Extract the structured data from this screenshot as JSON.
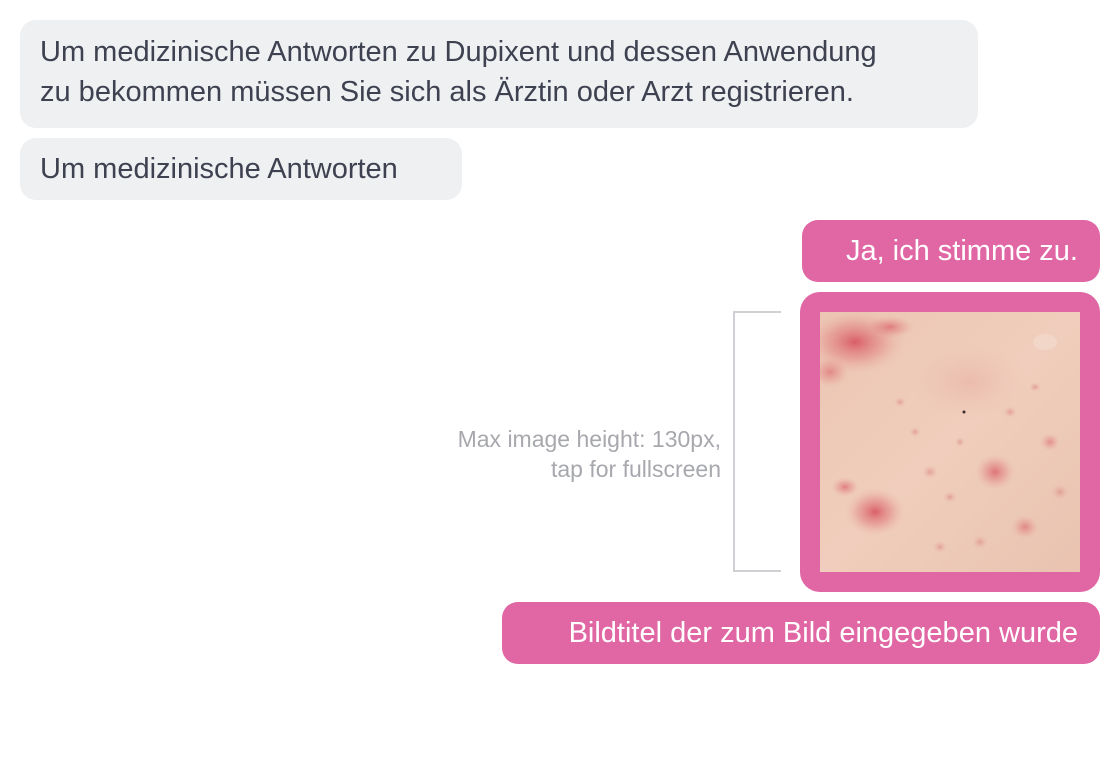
{
  "conversation": {
    "messages": [
      {
        "sender": "bot",
        "lines": [
          "Um medizinische Antworten zu Dupixent und dessen Anwendung",
          "zu bekommen müssen Sie sich als Ärztin oder Arzt registrieren."
        ]
      },
      {
        "sender": "bot",
        "text": "Um medizinische Antworten"
      },
      {
        "sender": "user",
        "text": "Ja, ich stimme zu."
      },
      {
        "sender": "user",
        "type": "image",
        "image_subject": "skin-rash-photo"
      },
      {
        "sender": "user",
        "text": "Bildtitel der zum Bild eingegeben wurde"
      }
    ]
  },
  "annotation": {
    "line1": "Max image height: 130px,",
    "line2": "tap for fullscreen"
  },
  "colors": {
    "incoming_bubble": "#eff0f2",
    "incoming_text": "#3e4150",
    "outgoing_bubble": "#e066a4",
    "outgoing_text": "#ffffff",
    "annotation": "#a7a8ad"
  }
}
